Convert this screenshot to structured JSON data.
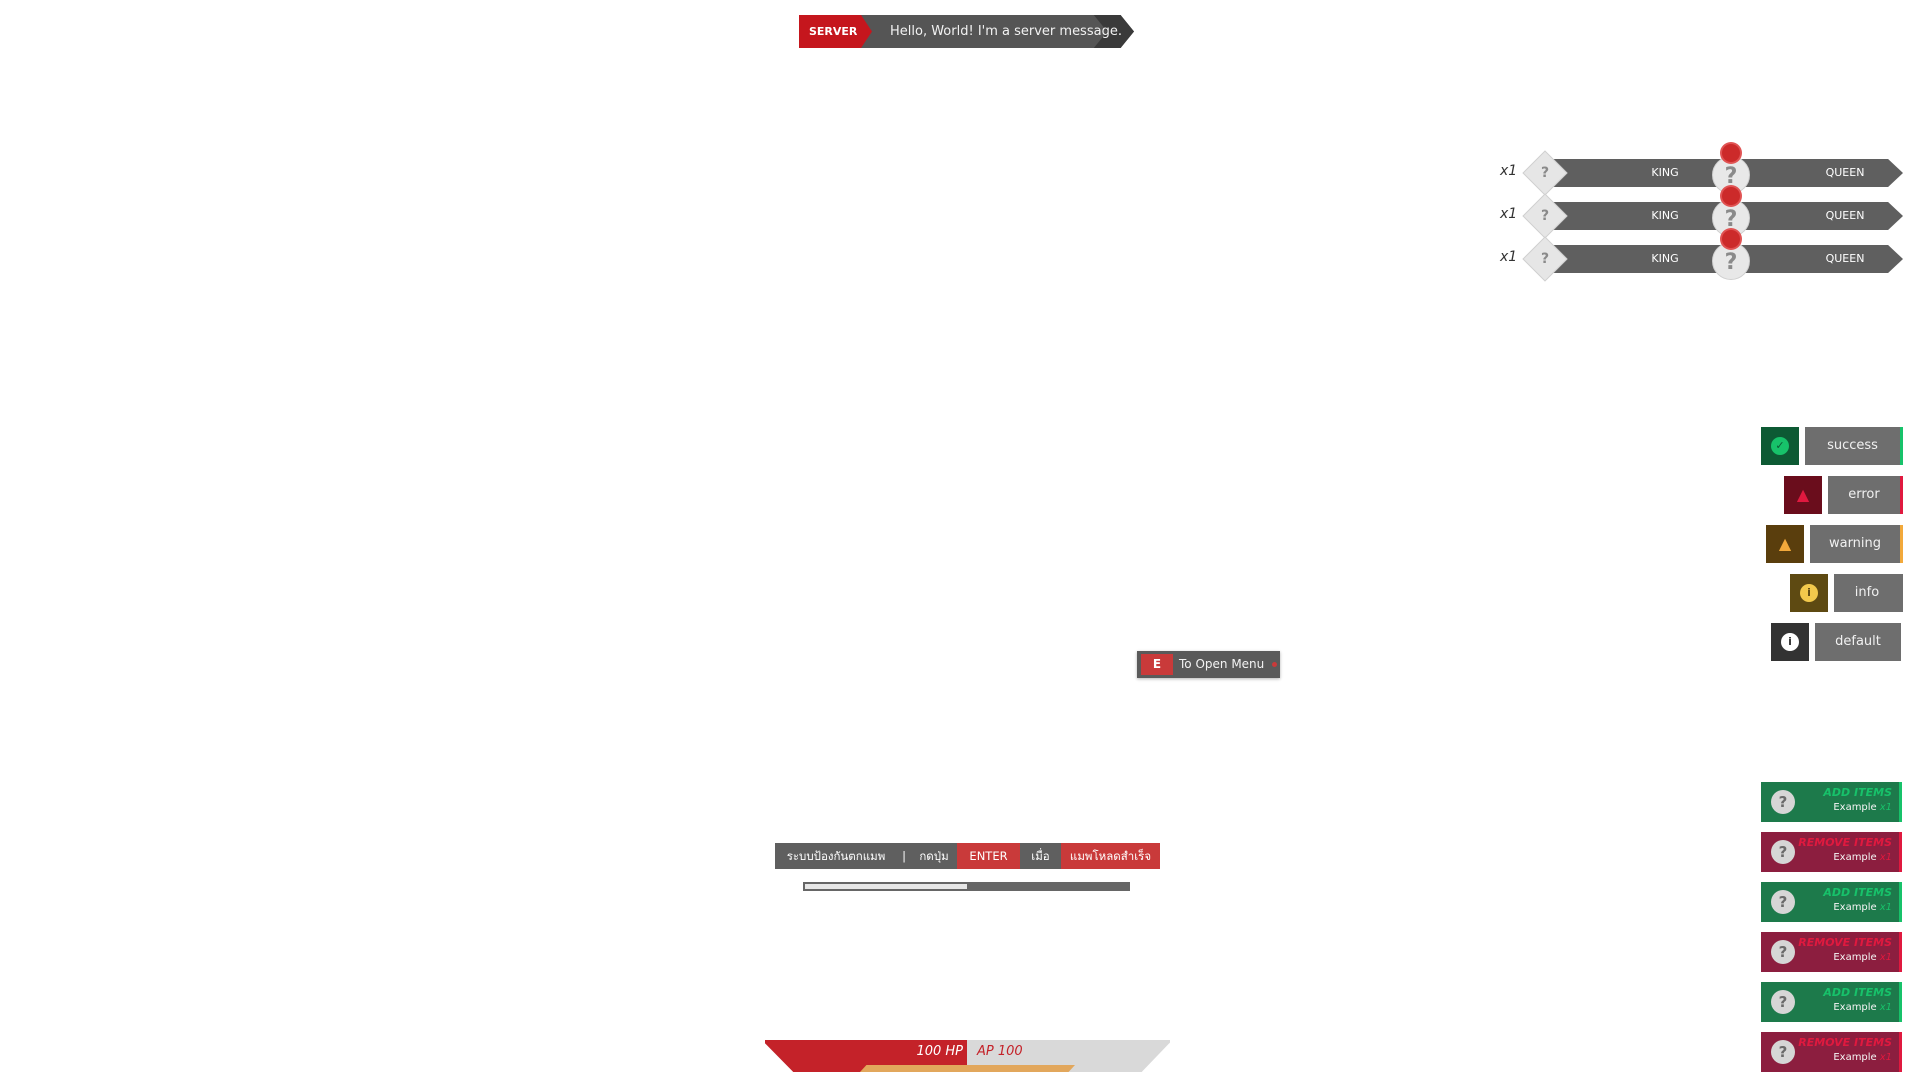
{
  "server_message": {
    "tag": "SERVER",
    "text": "Hello, World! I'm a server message."
  },
  "kill_feed": [
    {
      "count": "x1",
      "weapon_icon": "?",
      "killer": "KING",
      "victim": "QUEEN",
      "headshot": true
    },
    {
      "count": "x1",
      "weapon_icon": "?",
      "killer": "KING",
      "victim": "QUEEN",
      "headshot": true
    },
    {
      "count": "x1",
      "weapon_icon": "?",
      "killer": "KING",
      "victim": "QUEEN",
      "headshot": true
    }
  ],
  "notifications": [
    {
      "type": "success",
      "label": "success",
      "icon": "check-circle-icon",
      "accent": "#17c26a"
    },
    {
      "type": "error",
      "label": "error",
      "icon": "alert-triangle-icon",
      "accent": "#e0193f"
    },
    {
      "type": "warning",
      "label": "warning",
      "icon": "alert-triangle-icon",
      "accent": "#f2a93b"
    },
    {
      "type": "info",
      "label": "info",
      "icon": "info-circle-icon",
      "accent": "#f2c94c"
    },
    {
      "type": "default",
      "label": "default",
      "icon": "info-circle-icon",
      "accent": "#ffffff"
    }
  ],
  "interaction_hint": {
    "key": "E",
    "text": "To Open Menu"
  },
  "loading_bar": {
    "segments": [
      "ระบบป้องกันตกแมพ",
      "|",
      "กดปุ่ม",
      "ENTER",
      "เมื่อ",
      "แมพโหลดสำเร็จ"
    ],
    "progress": 0.5
  },
  "inventory_items": [
    {
      "action": "ADD ITEMS",
      "name": "Example",
      "qty": "x1",
      "kind": "add"
    },
    {
      "action": "REMOVE ITEMS",
      "name": "Example",
      "qty": "x1",
      "kind": "remove"
    },
    {
      "action": "ADD ITEMS",
      "name": "Example",
      "qty": "x1",
      "kind": "add"
    },
    {
      "action": "REMOVE ITEMS",
      "name": "Example",
      "qty": "x1",
      "kind": "remove"
    },
    {
      "action": "ADD ITEMS",
      "name": "Example",
      "qty": "x1",
      "kind": "add"
    },
    {
      "action": "REMOVE ITEMS",
      "name": "Example",
      "qty": "x1",
      "kind": "remove"
    }
  ],
  "hud": {
    "hp_text": "100 HP",
    "ap_text": "AP 100",
    "hp": 100,
    "armor": 100
  },
  "colors": {
    "brand_red": "#c42229",
    "panel_gray": "#5f5f5f",
    "add_green": "#17c26a",
    "add_bg": "#1d7a4b",
    "remove_red": "#e0193f",
    "remove_bg": "#8c1e3f",
    "armor_gold": "#e2a75c"
  }
}
